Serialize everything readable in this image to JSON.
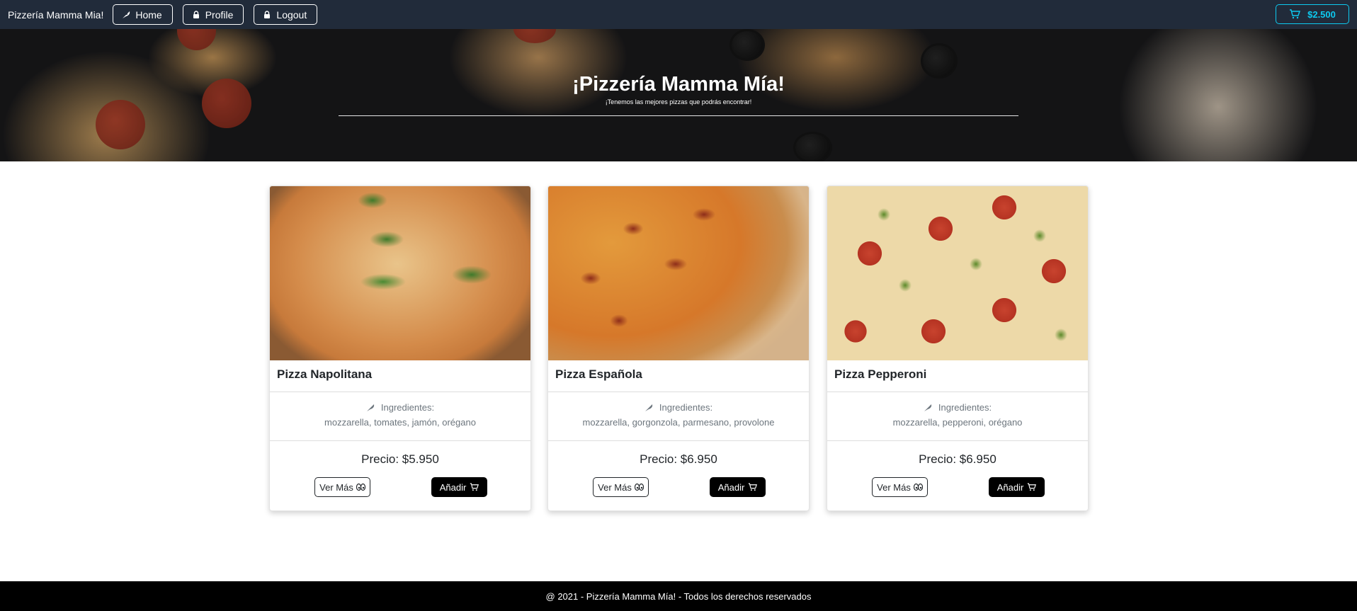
{
  "navbar": {
    "brand": "Pizzería Mamma Mia!",
    "links": [
      {
        "label": "Home",
        "icon": "pizza-slice-icon"
      },
      {
        "label": "Profile",
        "icon": "lock-icon"
      },
      {
        "label": "Logout",
        "icon": "lock-icon"
      }
    ],
    "cart_total": "$2.500",
    "cart_icon": "cart-icon"
  },
  "hero": {
    "title": "¡Pizzería Mamma Mía!",
    "subtitle": "¡Tenemos las mejores pizzas que podrás encontrar!"
  },
  "pizzas": [
    {
      "name": "Pizza Napolitana",
      "ingredients_label": "Ingredientes:",
      "ingredients": "mozzarella, tomates, jamón, orégano",
      "price": "Precio: $5.950",
      "more_label": "Ver Más",
      "add_label": "Añadir"
    },
    {
      "name": "Pizza Española",
      "ingredients_label": "Ingredientes:",
      "ingredients": "mozzarella, gorgonzola, parmesano, provolone",
      "price": "Precio: $6.950",
      "more_label": "Ver Más",
      "add_label": "Añadir"
    },
    {
      "name": "Pizza Pepperoni",
      "ingredients_label": "Ingredientes:",
      "ingredients": "mozzarella, pepperoni, orégano",
      "price": "Precio: $6.950",
      "more_label": "Ver Más",
      "add_label": "Añadir"
    }
  ],
  "footer": {
    "text": "@ 2021 - Pizzería Mamma Mía! - Todos los derechos reservados"
  },
  "colors": {
    "navbar_bg": "#212b3a",
    "cart_accent": "#0dcaf0",
    "footer_bg": "#000000",
    "add_button_bg": "#000000"
  }
}
